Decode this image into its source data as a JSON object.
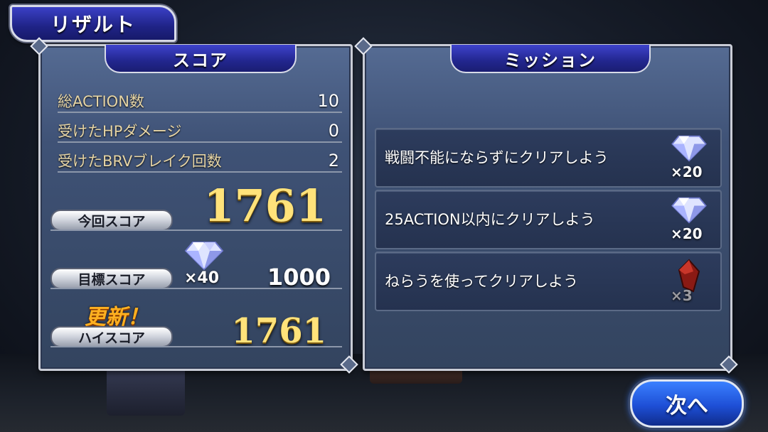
{
  "title": "リザルト",
  "score_panel": {
    "header": "スコア",
    "stats": [
      {
        "label": "総ACTION数",
        "value": "10"
      },
      {
        "label": "受けたHPダメージ",
        "value": "0"
      },
      {
        "label": "受けたBRVブレイク回数",
        "value": "2"
      }
    ],
    "current_score_label": "今回スコア",
    "current_score": "1761",
    "target_score_label": "目標スコア",
    "target_reward_count": "×40",
    "target_score": "1000",
    "updated_label": "更新！",
    "high_score_label": "ハイスコア",
    "high_score": "1761"
  },
  "mission_panel": {
    "header": "ミッション",
    "missions": [
      {
        "text": "戦闘不能にならずにクリアしよう",
        "reward_icon": "crystal-gem-icon",
        "reward_count": "×20"
      },
      {
        "text": "25ACTION以内にクリアしよう",
        "reward_icon": "crystal-gem-icon",
        "reward_count": "×20"
      },
      {
        "text": "ねらうを使ってクリアしよう",
        "reward_icon": "red-crystal-icon",
        "reward_count": "×3"
      }
    ]
  },
  "next_button": "次へ",
  "colors": {
    "tab_blue": "#22268e",
    "panel_blue": "#3f5276",
    "score_gold": "#ffe27a",
    "label_gold": "#e6d5a6",
    "updated_orange": "#ffb020",
    "next_blue": "#1e4fd6"
  }
}
